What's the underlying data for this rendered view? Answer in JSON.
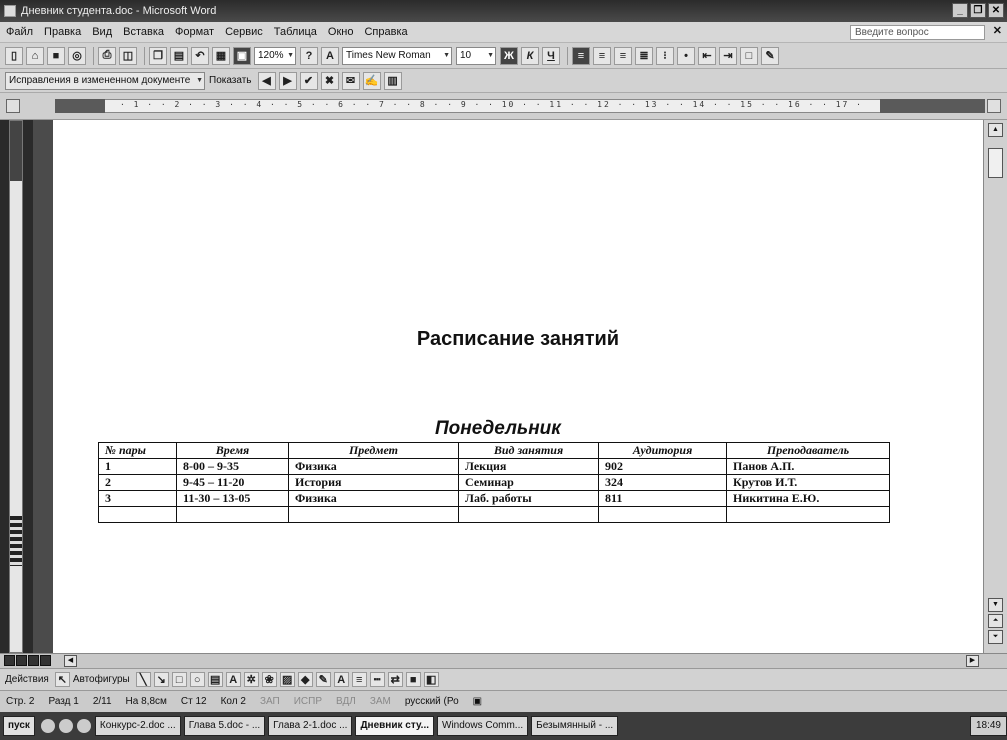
{
  "window": {
    "title": "Дневник студента.doc - Microsoft Word"
  },
  "menu": {
    "items": [
      "Файл",
      "Правка",
      "Вид",
      "Вставка",
      "Формат",
      "Сервис",
      "Таблица",
      "Окно",
      "Справка"
    ],
    "help_placeholder": "Введите вопрос"
  },
  "toolbar": {
    "zoom": "120%",
    "font_name": "Times New Roman",
    "font_size": "10"
  },
  "review_toolbar": {
    "mode": "Исправления в измененном документе",
    "show_label": "Показать"
  },
  "ruler": {
    "numbers": "· 1 · · 2 · · 3 · · 4 · · 5 · · 6 · · 7 · · 8 · · 9 · · 10 · · 11 · · 12 · · 13 · · 14 · · 15 · · 16 · · 17 ·"
  },
  "document": {
    "title": "Расписание занятий",
    "day": "Понедельник",
    "table": {
      "headers": [
        "№ пары",
        "Время",
        "Предмет",
        "Вид занятия",
        "Аудитория",
        "Преподаватель"
      ],
      "rows": [
        [
          "1",
          "8-00 – 9-35",
          "Физика",
          "Лекция",
          "902",
          "Панов А.П."
        ],
        [
          "2",
          "9-45 – 11-20",
          "История",
          "Семинар",
          "324",
          "Крутов И.Т."
        ],
        [
          "3",
          "11-30 – 13-05",
          "Физика",
          "Лаб. работы",
          "811",
          "Никитина Е.Ю."
        ],
        [
          "",
          "",
          "",
          "",
          "",
          ""
        ]
      ]
    }
  },
  "drawing_toolbar": {
    "actions_label": "Действия",
    "autoshapes_label": "Автофигуры"
  },
  "status": {
    "page": "Стр. 2",
    "section": "Разд 1",
    "pages": "2/11",
    "position": "На 8,8см",
    "line": "Ст 12",
    "column": "Кол 2",
    "rec": "ЗАП",
    "trk": "ИСПР",
    "ext": "ВДЛ",
    "ovr": "ЗАМ",
    "language": "русский (Ро"
  },
  "taskbar": {
    "start_label": "пуск",
    "tasks": [
      "Конкурс-2.doc ...",
      "Глава 5.doc - ...",
      "Глава 2-1.doc ...",
      "Дневник сту...",
      "Windows Comm...",
      "Безымянный - ..."
    ],
    "clock": "18:49"
  }
}
